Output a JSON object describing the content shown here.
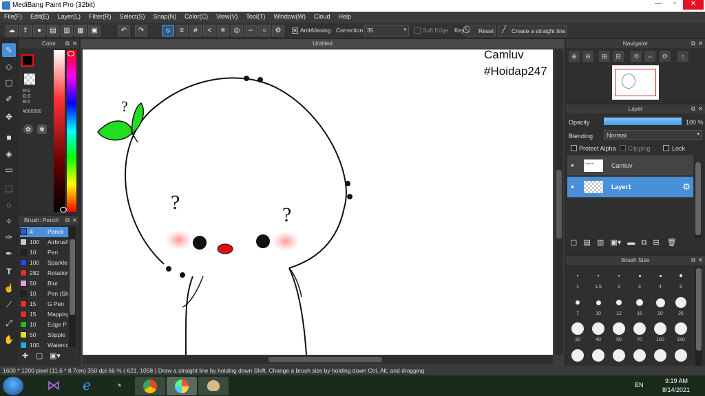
{
  "window": {
    "title": "MediBang Paint Pro (32bit)"
  },
  "menu": [
    "File(F)",
    "Edit(E)",
    "Layer(L)",
    "Filter(R)",
    "Select(S)",
    "Snap(N)",
    "Color(C)",
    "View(V)",
    "Tool(T)",
    "Window(W)",
    "Cloud",
    "Help"
  ],
  "toolbar": {
    "antialiasing_label": "AntiAliasing",
    "correction_label": "Correction",
    "correction_value": "35",
    "soft_edge_label": "Soft Edge",
    "key_label": "Key",
    "reset_label": "Reset",
    "straight_line_label": "Create a straight line"
  },
  "color_panel": {
    "title": "Color",
    "r": "R:0",
    "g": "G:0",
    "b": "B:0",
    "hex": "#000000"
  },
  "brush_panel": {
    "title": "Brush: Pencil",
    "items": [
      {
        "size": "4",
        "name": "Pencil",
        "color": "#2266cc"
      },
      {
        "size": "100",
        "name": "Airbrush",
        "color": "#cccccc"
      },
      {
        "size": "10",
        "name": "Pen",
        "color": "#222222"
      },
      {
        "size": "100",
        "name": "Sparkle",
        "color": "#3344ee"
      },
      {
        "size": "282",
        "name": "Rotation",
        "color": "#e03030"
      },
      {
        "size": "50",
        "name": "Blur",
        "color": "#e0a0e0"
      },
      {
        "size": "10",
        "name": "Pen (Sh",
        "color": "#222222"
      },
      {
        "size": "15",
        "name": "G Pen",
        "color": "#e03030"
      },
      {
        "size": "15",
        "name": "Mapping",
        "color": "#e03030"
      },
      {
        "size": "10",
        "name": "Edge P",
        "color": "#22bb22"
      },
      {
        "size": "50",
        "name": "Stipple",
        "color": "#dddd22"
      },
      {
        "size": "100",
        "name": "Watercolor",
        "color": "#22aaee"
      }
    ]
  },
  "canvas": {
    "tab_title": "Untitled",
    "text_line1": "Camluv",
    "text_line2": "#Hoidap247"
  },
  "navigator": {
    "title": "Navigator"
  },
  "layer_panel": {
    "title": "Layer",
    "opacity_label": "Opacity",
    "opacity_value": "100 %",
    "opacity": 1.0,
    "blending_label": "Blending",
    "blending_value": "Normal",
    "protect_alpha": "Protect Alpha",
    "clipping": "Clipping",
    "lock": "Lock",
    "layers": [
      {
        "name": "Camluv",
        "selected": false
      },
      {
        "name": "Layer1",
        "selected": true
      }
    ]
  },
  "brush_size": {
    "title": "Brush Size",
    "sizes": [
      "1",
      "1.5",
      "2",
      "3",
      "4",
      "5",
      "7",
      "10",
      "12",
      "15",
      "20",
      "25",
      "30",
      "40",
      "50",
      "70",
      "100",
      "150"
    ]
  },
  "status": {
    "text": "1600 * 1200 pixel   (11.6 * 8.7cm)   350 dpi   66 %   ( 621, 1058 )   Draw a straight line by holding down Shift, Change a brush size by holding down Ctrl, Alt, and dragging"
  },
  "taskbar": {
    "lang": "EN",
    "time": "9:19 AM",
    "date": "8/14/2021"
  }
}
